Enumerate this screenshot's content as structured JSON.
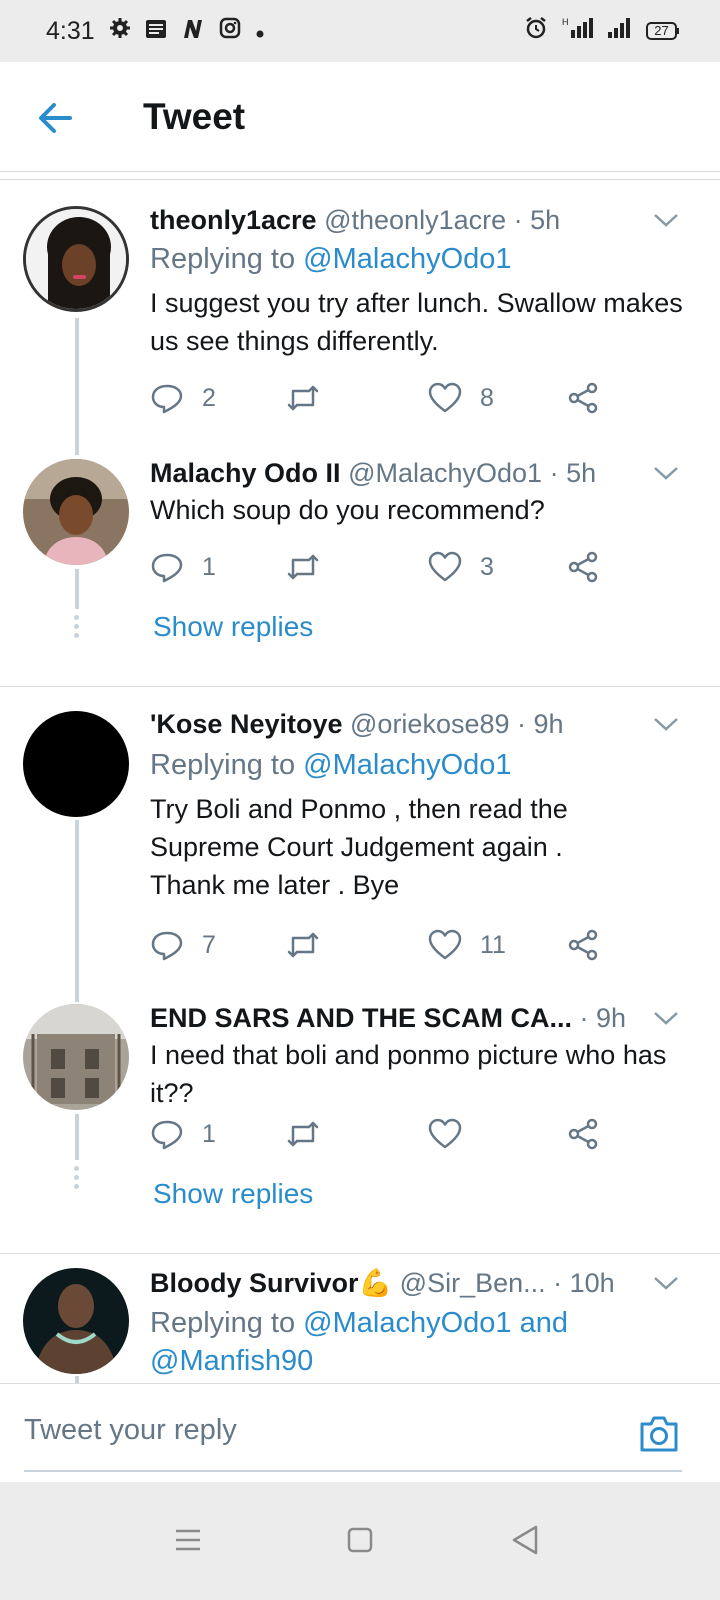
{
  "status_bar": {
    "time": "4:31",
    "left_icons": [
      "gear-icon",
      "news-icon",
      "n-app-icon",
      "instagram-icon",
      "dot-icon"
    ],
    "battery": "27"
  },
  "app_bar": {
    "title": "Tweet"
  },
  "tweets": [
    {
      "name": "theonly1acre",
      "handle": "@theonly1acre",
      "time": "· 5h",
      "replying_prefix": "Replying to ",
      "replying_to": "@MalachyOdo1",
      "text": "I suggest you try after lunch. Swallow makes us see things differently.",
      "replies": "2",
      "retweets": "",
      "likes": "8"
    },
    {
      "name": "Malachy Odo II",
      "handle": "@MalachyOdo1",
      "time": "· 5h",
      "text": "Which soup do you recommend?",
      "replies": "1",
      "retweets": "",
      "likes": "3",
      "show_replies": "Show replies"
    },
    {
      "name": "'Kose Neyitoye",
      "handle": "@oriekose89",
      "time": "· 9h",
      "replying_prefix": "Replying to ",
      "replying_to": "@MalachyOdo1",
      "text": "Try Boli and Ponmo , then read the Supreme Court Judgement again . Thank me later . Bye",
      "replies": "7",
      "retweets": "",
      "likes": "11"
    },
    {
      "name": "END SARS AND THE SCAM CA...",
      "handle": "",
      "time": "· 9h",
      "text": "I need that boli and ponmo picture  who has it??",
      "replies": "1",
      "retweets": "",
      "likes": "",
      "show_replies": "Show replies"
    },
    {
      "name": "Bloody Survivor💪",
      "handle": "@Sir_Ben...",
      "time": "· 10h",
      "replying_prefix": "Replying to ",
      "replying_to": "@MalachyOdo1 and",
      "replying_to_2": "@Manfish90"
    }
  ],
  "reply_bar": {
    "placeholder": "Tweet your reply"
  },
  "colors": {
    "accent": "#2b8ccc",
    "muted": "#657786",
    "text": "#14171a",
    "divider": "#d8dde2"
  }
}
